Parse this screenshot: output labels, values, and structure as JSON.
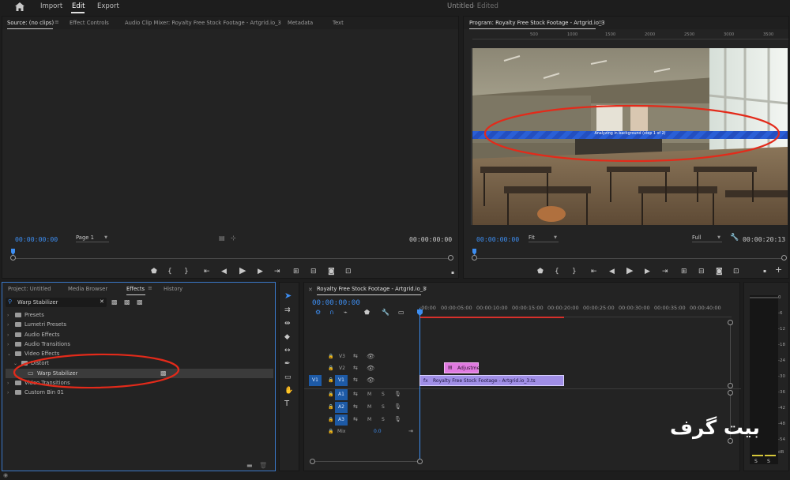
{
  "topbar": {
    "import": "Import",
    "edit": "Edit",
    "export": "Export",
    "project_title": "Untitled",
    "project_status": "- Edited"
  },
  "source": {
    "tabs": [
      "Source: (no clips)",
      "Effect Controls",
      "Audio Clip Mixer: Royalty Free Stock Footage - Artgrid.io_3",
      "Metadata",
      "Text"
    ],
    "timecode_left": "00:00:00:00",
    "page_select": "Page 1",
    "timecode_right": "00:00:00:00"
  },
  "program": {
    "tab": "Program: Royalty Free Stock Footage - Artgrid.io_3",
    "ruler_ticks": [
      "500",
      "1000",
      "1500",
      "2000",
      "2500",
      "3000",
      "3500"
    ],
    "overlay_text": "Analyzing in background (step 1 of 2)",
    "timecode_left": "00:00:00:00",
    "fit_select": "Fit",
    "quality_select": "Full",
    "timecode_right": "00:00:20:13"
  },
  "project": {
    "tabs": [
      "Project: Untitled",
      "Media Browser",
      "Effects",
      "History"
    ],
    "search_value": "Warp Stabilizer",
    "tree": [
      {
        "label": "Presets",
        "level": 0
      },
      {
        "label": "Lumetri Presets",
        "level": 0
      },
      {
        "label": "Audio Effects",
        "level": 0
      },
      {
        "label": "Audio Transitions",
        "level": 0
      },
      {
        "label": "Video Effects",
        "level": 0
      },
      {
        "label": "Distort",
        "level": 1
      },
      {
        "label": "Warp Stabilizer",
        "level": 2
      },
      {
        "label": "Video Transitions",
        "level": 0
      },
      {
        "label": "Custom Bin 01",
        "level": 0
      }
    ]
  },
  "timeline": {
    "tab": "Royalty Free Stock Footage - Artgrid.io_3",
    "timecode": "00:00:00:00",
    "ruler": [
      ":00:00",
      "00:00:05:00",
      "00:00:10:00",
      "00:00:15:00",
      "00:00:20:00",
      "00:00:25:00",
      "00:00:30:00",
      "00:00:35:00",
      "00:00:40:00"
    ],
    "tracks_video": [
      "V3",
      "V2",
      "V1"
    ],
    "tracks_audio": [
      "A1",
      "A2",
      "A3"
    ],
    "source_patch_v": "V1",
    "mix_label": "Mix",
    "mix_value": "0.0",
    "clip_adjustment": "Adjustme",
    "clip_fx": "fx",
    "clip_main": "Royalty Free Stock Footage - Artgrid.io_3.ts",
    "m": "M",
    "s": "S"
  },
  "meter": {
    "scale": [
      "0",
      "-6",
      "-12",
      "-18",
      "-24",
      "-30",
      "-36",
      "-42",
      "-48",
      "-54",
      "dB"
    ],
    "solo_left": "S",
    "solo_right": "S"
  },
  "watermark": "بیت گرف",
  "colors": {
    "accent_blue": "#3d8ef2",
    "overlay_bar": "#2a5fd6",
    "annotation_red": "#e32a1a",
    "clip_purple": "#a08ee6",
    "clip_pink": "#e07ae0"
  }
}
